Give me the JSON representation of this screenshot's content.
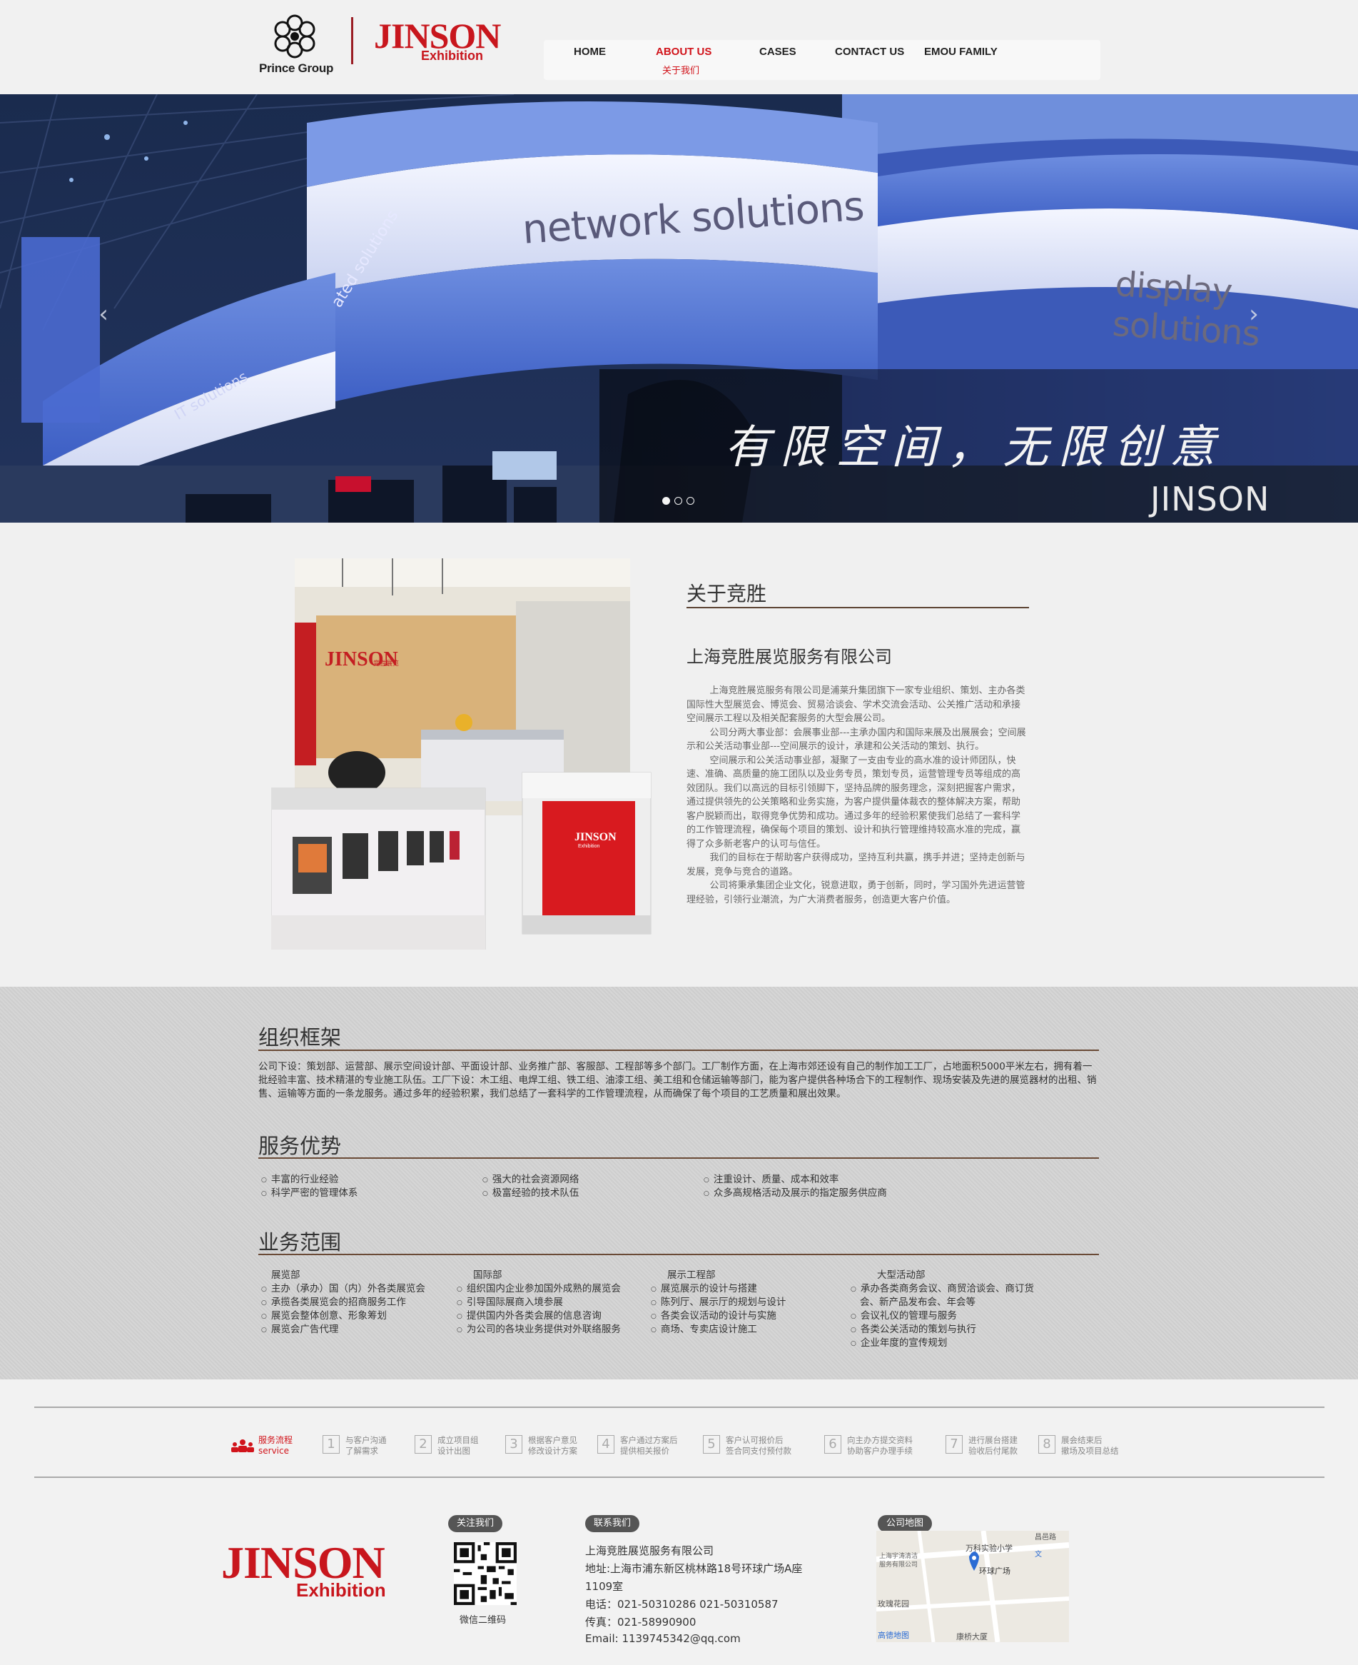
{
  "brand": {
    "prince_group": "Prince Group",
    "jinson": "JINSON",
    "exhibition": "Exhibition"
  },
  "nav": {
    "items": [
      {
        "label": "HOME",
        "sub": ""
      },
      {
        "label": "ABOUT US",
        "sub": "关于我们"
      },
      {
        "label": "CASES",
        "sub": ""
      },
      {
        "label": "CONTACT US",
        "sub": ""
      },
      {
        "label": "EMOU FAMILY",
        "sub": ""
      }
    ],
    "active_color": "#d1141b"
  },
  "banner": {
    "text_network": "network solutions",
    "text_display": "display solutions",
    "text_nec_solutions": "ated solutions",
    "text_it": "IT solutions",
    "slogan": "有限空间，无限创意",
    "watermark": "JINSON",
    "prev_icon": "chevron-left-icon",
    "next_icon": "chevron-right-icon",
    "slide_count": 3,
    "active_slide": 1
  },
  "about": {
    "title": "关于竞胜",
    "company_name": "上海竞胜展览服务有限公司",
    "photo_sign": "JINSON",
    "photo_sign_sub": "Exhibition",
    "paragraphs": [
      "上海竞胜展览服务有限公司是浦莱升集团旗下一家专业组织、策划、主办各类国际性大型展览会、博览会、贸易洽谈会、学术交流会活动、公关推广活动和承接空间展示工程以及相关配套服务的大型会展公司。",
      "公司分两大事业部：会展事业部---主承办国内和国际来展及出展展会；空间展示和公关活动事业部---空间展示的设计，承建和公关活动的策划、执行。",
      "空间展示和公关活动事业部，凝聚了一支由专业的高水准的设计师团队，快速、准确、高质量的施工团队以及业务专员，策划专员，运营管理专员等组成的高效团队。我们以高远的目标引领脚下，坚持品牌的服务理念，深刻把握客户需求，通过提供领先的公关策略和业务实施，为客户提供量体裁衣的整体解决方案，帮助客户脱颖而出，取得竞争优势和成功。通过多年的经验积累使我们总结了一套科学的工作管理流程，确保每个项目的策划、设计和执行管理维持较高水准的完成，赢得了众多新老客户的认可与信任。",
      "我们的目标在于帮助客户获得成功，坚持互利共赢，携手并进；坚持走创新与发展，竞争与竞合的道路。",
      "公司将秉承集团企业文化，锐意进取，勇于创新，同时，学习国外先进运营管理经验，引领行业潮流，为广大消费者服务，创造更大客户价值。"
    ]
  },
  "org": {
    "title": "组织框架",
    "text": "公司下设：策划部、运营部、展示空间设计部、平面设计部、业务推广部、客服部、工程部等多个部门。工厂制作方面，在上海市郊还设有自己的制作加工工厂，占地面积5000平米左右，拥有着一批经验丰富、技术精湛的专业施工队伍。工厂下设：木工组、电焊工组、铁工组、油漆工组、美工组和仓储运输等部门，能为客户提供各种场合下的工程制作、现场安装及先进的展览器材的出租、销售、运输等方面的一条龙服务。通过多年的经验积累，我们总结了一套科学的工作管理流程，从而确保了每个项目的工艺质量和展出效果。"
  },
  "advantages": {
    "title": "服务优势",
    "items": [
      "丰富的行业经验",
      "强大的社会资源网络",
      "注重设计、质量、成本和效率",
      "科学严密的管理体系",
      "极富经验的技术队伍",
      "众多高规格活动及展示的指定服务供应商"
    ]
  },
  "business": {
    "title": "业务范围",
    "columns": [
      {
        "head": "展览部",
        "items": [
          "主办（承办）国（内）外各类展览会",
          "承揽各类展览会的招商服务工作",
          "展览会整体创意、形象筹划",
          "展览会广告代理"
        ]
      },
      {
        "head": "国际部",
        "items": [
          "组织国内企业参加国外成熟的展览会",
          "引导国际展商入境参展",
          "提供国内外各类会展的信息咨询",
          "为公司的各块业务提供对外联络服务"
        ]
      },
      {
        "head": "展示工程部",
        "items": [
          "展览展示的设计与搭建",
          "陈列厅、展示厅的规划与设计",
          "各类会议活动的设计与实施",
          "商场、专卖店设计施工"
        ]
      },
      {
        "head": "大型活动部",
        "items": [
          "承办各类商务会议、商贸洽谈会、商订货",
          "会、新产品发布会、年会等",
          "会议礼仪的管理与服务",
          "各类公关活动的策划与执行",
          "企业年度的宣传规划"
        ]
      }
    ]
  },
  "process": {
    "label": "服务流程",
    "label_en": "service",
    "steps": [
      {
        "num": "1",
        "line1": "与客户沟通",
        "line2": "了解需求"
      },
      {
        "num": "2",
        "line1": "成立项目组",
        "line2": "设计出图"
      },
      {
        "num": "3",
        "line1": "根据客户意见",
        "line2": "修改设计方案"
      },
      {
        "num": "4",
        "line1": "客户通过方案后",
        "line2": "提供相关报价"
      },
      {
        "num": "5",
        "line1": "客户认可报价后",
        "line2": "签合同支付预付款"
      },
      {
        "num": "6",
        "line1": "向主办方提交资料",
        "line2": "协助客户办理手续"
      },
      {
        "num": "7",
        "line1": "进行展台搭建",
        "line2": "验收后付尾款"
      },
      {
        "num": "8",
        "line1": "展会结束后",
        "line2": "撤场及项目总结"
      }
    ]
  },
  "footer": {
    "follow_label": "关注我们",
    "qr_caption": "微信二维码",
    "contact_label": "联系我们",
    "company": "上海竞胜展览服务有限公司",
    "address_line1": "地址:上海市浦东新区桃林路18号环球广场A座",
    "address_line2": "1109室",
    "phone": "电话：021-50310286 021-50310587",
    "fax": "传真：021-58990900",
    "email": "Email: 1139745342@qq.com",
    "map_label": "公司地图",
    "map_labels": [
      "昌邑路",
      "万科实验小学",
      "上海宇涛清洁",
      "服务有限公司",
      "环球广场",
      "玫瑰花园",
      "高德地图",
      "康桥大厦",
      "文"
    ]
  }
}
